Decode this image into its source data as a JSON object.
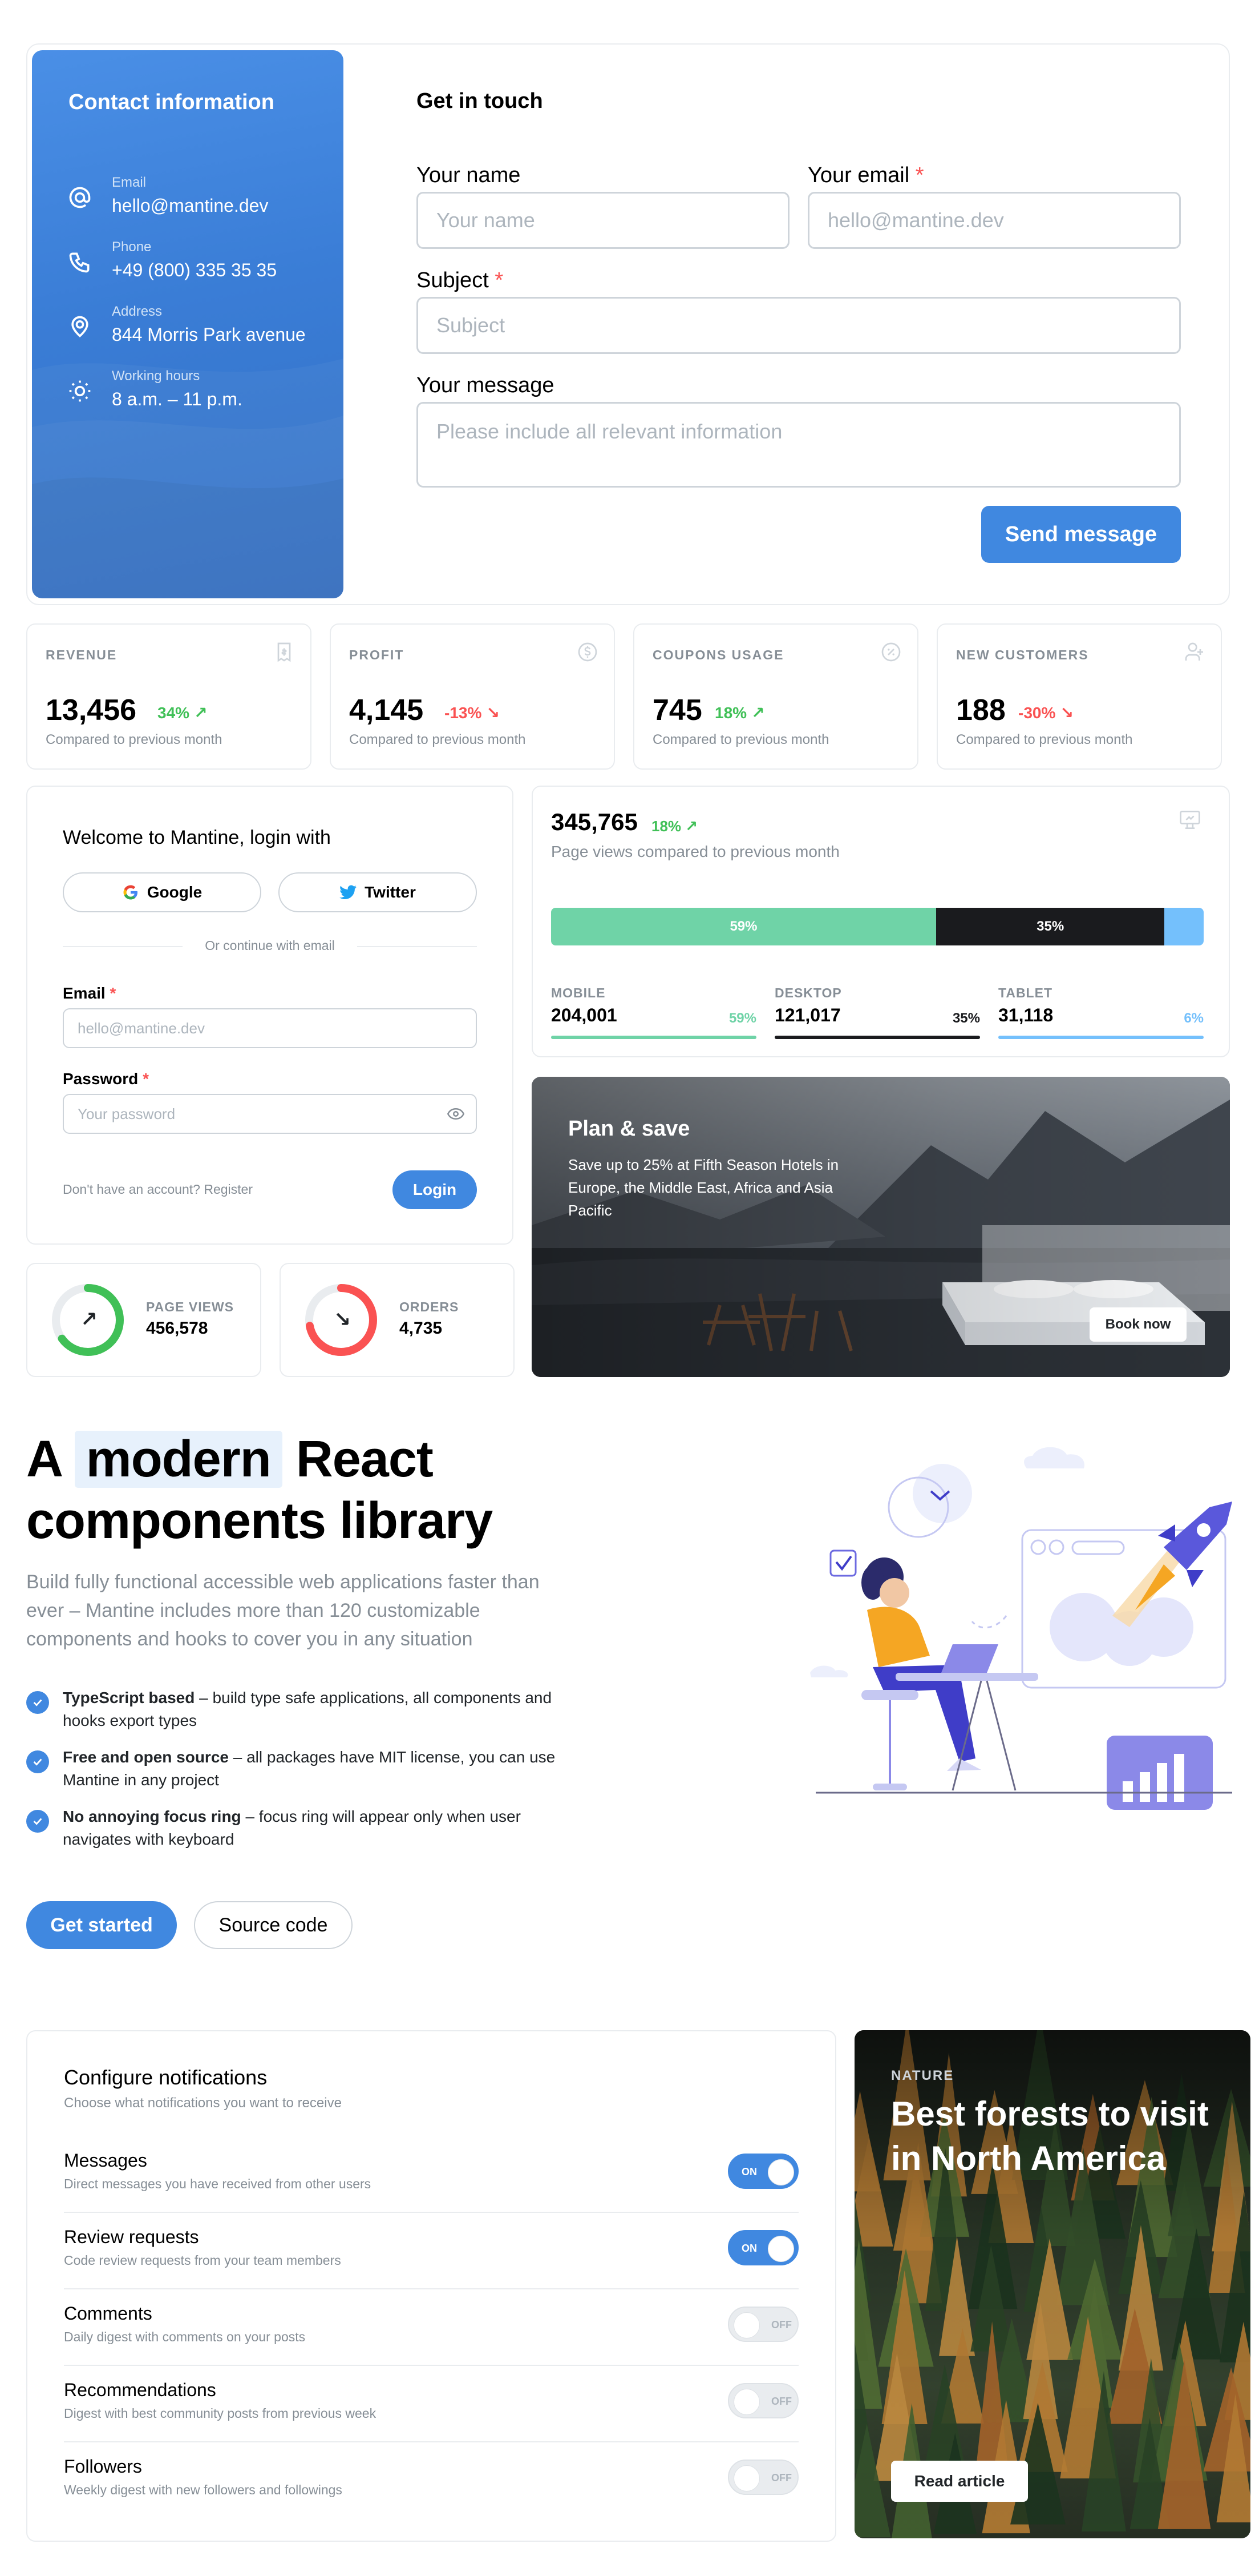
{
  "contact": {
    "panel_title": "Contact information",
    "items": [
      {
        "label": "Email",
        "value": "hello@mantine.dev",
        "icon": "at-icon"
      },
      {
        "label": "Phone",
        "value": "+49 (800) 335 35 35",
        "icon": "phone-icon"
      },
      {
        "label": "Address",
        "value": "844 Morris Park avenue",
        "icon": "map-pin-icon"
      },
      {
        "label": "Working hours",
        "value": "8 a.m. – 11 p.m.",
        "icon": "sun-icon"
      }
    ],
    "form_title": "Get in touch",
    "name_label": "Your name",
    "name_placeholder": "Your name",
    "email_label": "Your email",
    "email_placeholder": "hello@mantine.dev",
    "subject_label": "Subject",
    "subject_placeholder": "Subject",
    "message_label": "Your message",
    "message_placeholder": "Please include all relevant information",
    "required_mark": "*",
    "send_button": "Send message"
  },
  "stats": [
    {
      "title": "REVENUE",
      "value": "13,456",
      "diff": "34%",
      "trend": "up",
      "sub": "Compared to previous month",
      "icon": "receipt-icon"
    },
    {
      "title": "PROFIT",
      "value": "4,145",
      "diff": "-13%",
      "trend": "down",
      "sub": "Compared to previous month",
      "icon": "coin-icon"
    },
    {
      "title": "COUPONS USAGE",
      "value": "745",
      "diff": "18%",
      "trend": "up",
      "sub": "Compared to previous month",
      "icon": "discount-icon"
    },
    {
      "title": "NEW CUSTOMERS",
      "value": "188",
      "diff": "-30%",
      "trend": "down",
      "sub": "Compared to previous month",
      "icon": "user-plus-icon"
    }
  ],
  "login": {
    "title": "Welcome to Mantine, login with",
    "google": "Google",
    "twitter": "Twitter",
    "divider": "Or continue with email",
    "email_label": "Email",
    "email_placeholder": "hello@mantine.dev",
    "password_label": "Password",
    "password_placeholder": "Your password",
    "register": "Don't have an account? Register",
    "login_button": "Login"
  },
  "rings": [
    {
      "label": "PAGE VIEWS",
      "value": "456,578",
      "progress": 0.65,
      "color": "#40c057",
      "icon": "arrow-up-right-icon"
    },
    {
      "label": "ORDERS",
      "value": "4,735",
      "progress": 0.72,
      "color": "#fa5252",
      "icon": "arrow-down-right-icon"
    }
  ],
  "pageviews": {
    "value": "345,765",
    "diff": "18%",
    "sub": "Page views compared to previous month",
    "icon": "device-analytics-icon",
    "segments": [
      {
        "label": "MOBILE",
        "count": "204,001",
        "part": "59%",
        "fraction": 0.59,
        "color": "#6fd3a7",
        "text_color": "#ffffff"
      },
      {
        "label": "DESKTOP",
        "count": "121,017",
        "part": "35%",
        "fraction": 0.35,
        "color": "#1a1b1e",
        "text_color": "#ffffff"
      },
      {
        "label": "TABLET",
        "count": "31,118",
        "part": "6%",
        "fraction": 0.06,
        "color": "#74c0fc",
        "text_color": "#74c0fc"
      }
    ]
  },
  "promo": {
    "title": "Plan & save",
    "text": "Save up to 25% at Fifth Season Hotels in Europe, the Middle East, Africa and Asia Pacific",
    "button": "Book now"
  },
  "hero": {
    "title_pre": "A",
    "title_highlight": "modern",
    "title_post": "React",
    "title_line2": "components library",
    "description": "Build fully functional accessible web applications faster than ever – Mantine includes more than 120 customizable components and hooks to cover you in any situation",
    "features": [
      {
        "bold": "TypeScript based",
        "text": " – build type safe applications, all components and hooks export types"
      },
      {
        "bold": "Free and open source",
        "text": " – all packages have MIT license, you can use Mantine in any project"
      },
      {
        "bold": "No annoying focus ring",
        "text": " – focus ring will appear only when user navigates with keyboard"
      }
    ],
    "primary_button": "Get started",
    "secondary_button": "Source code"
  },
  "notifications": {
    "title": "Configure notifications",
    "subtitle": "Choose what notifications you want to receive",
    "items": [
      {
        "title": "Messages",
        "desc": "Direct messages you have received from other users",
        "state": "ON"
      },
      {
        "title": "Review requests",
        "desc": "Code review requests from your team members",
        "state": "ON"
      },
      {
        "title": "Comments",
        "desc": "Daily digest with comments on your posts",
        "state": "OFF"
      },
      {
        "title": "Recommendations",
        "desc": "Digest with best community posts from previous week",
        "state": "OFF"
      },
      {
        "title": "Followers",
        "desc": "Weekly digest with new followers and followings",
        "state": "OFF"
      }
    ]
  },
  "article": {
    "category": "NATURE",
    "title": "Best forests to visit in North America",
    "button": "Read article"
  }
}
